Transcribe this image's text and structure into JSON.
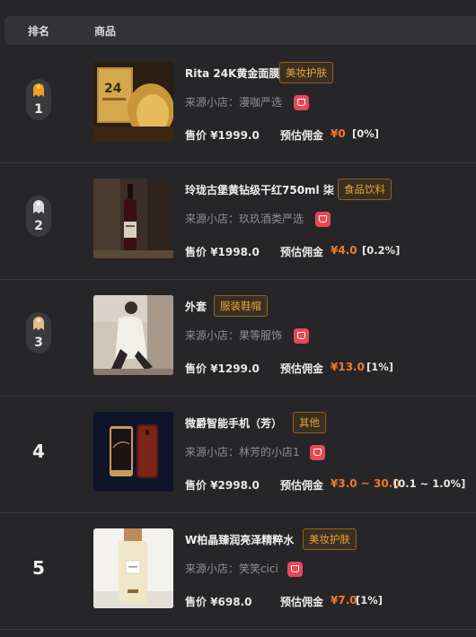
{
  "header": {
    "rank_label": "排名",
    "product_label": "商品"
  },
  "shop_prefix": "来源小店：",
  "price_prefix": "售价 ",
  "commission_label": "预估佣金",
  "rows": [
    {
      "rank": "1",
      "name": "Rita 24K黄金面膜",
      "tag": "美妆护肤",
      "shop": "漫咖严选",
      "price": "¥1999.0",
      "commission": "¥0",
      "rate": "[0%]"
    },
    {
      "rank": "2",
      "name": "玲珑古堡黄钻级干红750ml 柒",
      "tag": "食品饮料",
      "shop": "玖玖酒类严选",
      "price": "¥1998.0",
      "commission": "¥4.0",
      "rate": "[0.2%]"
    },
    {
      "rank": "3",
      "name": "外套",
      "tag": "服装鞋帽",
      "shop": "果等服饰",
      "price": "¥1299.0",
      "commission": "¥13.0",
      "rate": "[1%]"
    },
    {
      "rank": "4",
      "name": "微爵智能手机（芳）",
      "tag": "其他",
      "shop": "林芳的小店1",
      "price": "¥2998.0",
      "commission": "¥3.0 ~ 30.0",
      "rate": "[0.1 ~ 1.0%]"
    },
    {
      "rank": "5",
      "name": "W柏晶臻润亮泽精粹水",
      "tag": "美妆护肤",
      "shop": "笑笑cici",
      "price": "¥698.0",
      "commission": "¥7.0",
      "rate": "[1%]"
    }
  ],
  "colors": {
    "gold_medal": "#f0a020",
    "silver_medal": "#d8d8d8",
    "bronze_medal": "#e0be88",
    "accent": "#f07a2a",
    "tag_text": "#e8a33d",
    "shop_icon": "#e6495a"
  }
}
